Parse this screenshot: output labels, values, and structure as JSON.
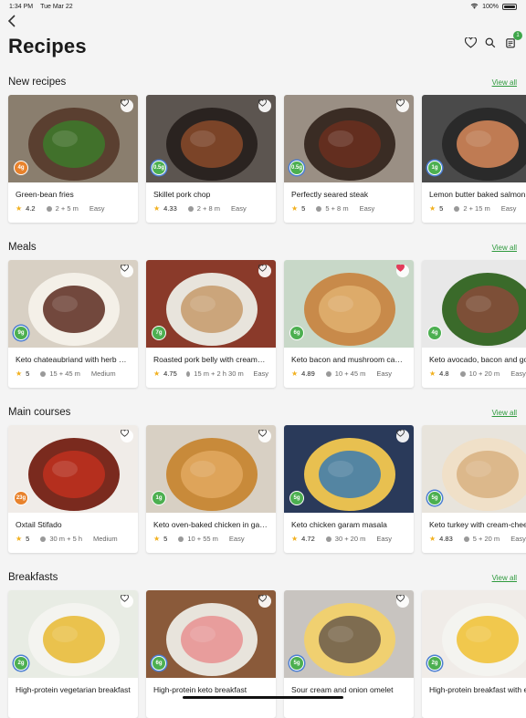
{
  "status": {
    "time": "1:34 PM",
    "date": "Tue Mar 22",
    "battery": "100%"
  },
  "header": {
    "title": "Recipes",
    "cart_count": "1"
  },
  "colors": {
    "accent": "#2f9a3e",
    "carb_orange": "#e8822c",
    "carb_green": "#4caf50",
    "star": "#f2b01e",
    "heart_active": "#e23c5a"
  },
  "sections": [
    {
      "title": "New recipes",
      "view_all": "View all",
      "cards": [
        {
          "name": "Green-bean fries",
          "carbs": "4g",
          "carb_color": "#e8822c",
          "ring": false,
          "rating": "4.2",
          "time": "2 + 5 m",
          "difficulty": "Easy",
          "favorited": false
        },
        {
          "name": "Skillet pork chop",
          "carbs": "0.5g",
          "carb_color": "#4caf50",
          "ring": true,
          "rating": "4.33",
          "time": "2 + 8 m",
          "difficulty": "Easy",
          "favorited": false
        },
        {
          "name": "Perfectly seared steak",
          "carbs": "0.5g",
          "carb_color": "#4caf50",
          "ring": true,
          "rating": "5",
          "time": "5 + 8 m",
          "difficulty": "Easy",
          "favorited": false
        },
        {
          "name": "Lemon butter baked salmon",
          "carbs": "1g",
          "carb_color": "#4caf50",
          "ring": true,
          "rating": "5",
          "time": "2 + 15 m",
          "difficulty": "Easy",
          "favorited": false
        }
      ]
    },
    {
      "title": "Meals",
      "view_all": "View all",
      "cards": [
        {
          "name": "Keto chateaubriand with herb butter",
          "carbs": "9g",
          "carb_color": "#4caf50",
          "ring": true,
          "rating": "5",
          "time": "15 + 45 m",
          "difficulty": "Medium",
          "favorited": false
        },
        {
          "name": "Roasted pork belly with creamy cabbage",
          "carbs": "7g",
          "carb_color": "#4caf50",
          "ring": false,
          "rating": "4.75",
          "time": "15 m + 2 h 30 m",
          "difficulty": "Easy",
          "favorited": false
        },
        {
          "name": "Keto bacon and mushroom casserole",
          "carbs": "6g",
          "carb_color": "#4caf50",
          "ring": false,
          "rating": "4.89",
          "time": "10 + 45 m",
          "difficulty": "Easy",
          "favorited": true
        },
        {
          "name": "Keto avocado, bacon and goat cheese salad",
          "carbs": "4g",
          "carb_color": "#4caf50",
          "ring": false,
          "rating": "4.8",
          "time": "10 + 20 m",
          "difficulty": "Easy",
          "favorited": false
        }
      ]
    },
    {
      "title": "Main courses",
      "view_all": "View all",
      "cards": [
        {
          "name": "Oxtail Stifado",
          "carbs": "23g",
          "carb_color": "#e8822c",
          "ring": false,
          "rating": "5",
          "time": "30 m + 5 h",
          "difficulty": "Medium",
          "favorited": false
        },
        {
          "name": "Keto oven-baked chicken in garlic butter",
          "carbs": "1g",
          "carb_color": "#4caf50",
          "ring": false,
          "rating": "5",
          "time": "10 + 55 m",
          "difficulty": "Easy",
          "favorited": false
        },
        {
          "name": "Keto chicken garam masala",
          "carbs": "5g",
          "carb_color": "#4caf50",
          "ring": false,
          "rating": "4.72",
          "time": "30 + 20 m",
          "difficulty": "Easy",
          "favorited": false
        },
        {
          "name": "Keto turkey with cream-cheese sauce",
          "carbs": "5g",
          "carb_color": "#4caf50",
          "ring": true,
          "rating": "4.83",
          "time": "5 + 20 m",
          "difficulty": "Easy",
          "favorited": false
        }
      ]
    },
    {
      "title": "Breakfasts",
      "view_all": "View all",
      "cards": [
        {
          "name": "High-protein vegetarian breakfast",
          "carbs": "2g",
          "carb_color": "#4caf50",
          "ring": true,
          "rating": "",
          "time": "",
          "difficulty": "",
          "favorited": false
        },
        {
          "name": "High-protein keto breakfast",
          "carbs": "6g",
          "carb_color": "#4caf50",
          "ring": true,
          "rating": "",
          "time": "",
          "difficulty": "",
          "favorited": false
        },
        {
          "name": "Sour cream and onion omelet",
          "carbs": "5g",
          "carb_color": "#4caf50",
          "ring": true,
          "rating": "",
          "time": "",
          "difficulty": "",
          "favorited": false
        },
        {
          "name": "High-protein breakfast with eggs",
          "carbs": "2g",
          "carb_color": "#4caf50",
          "ring": true,
          "rating": "",
          "time": "",
          "difficulty": "",
          "favorited": false
        }
      ]
    }
  ]
}
